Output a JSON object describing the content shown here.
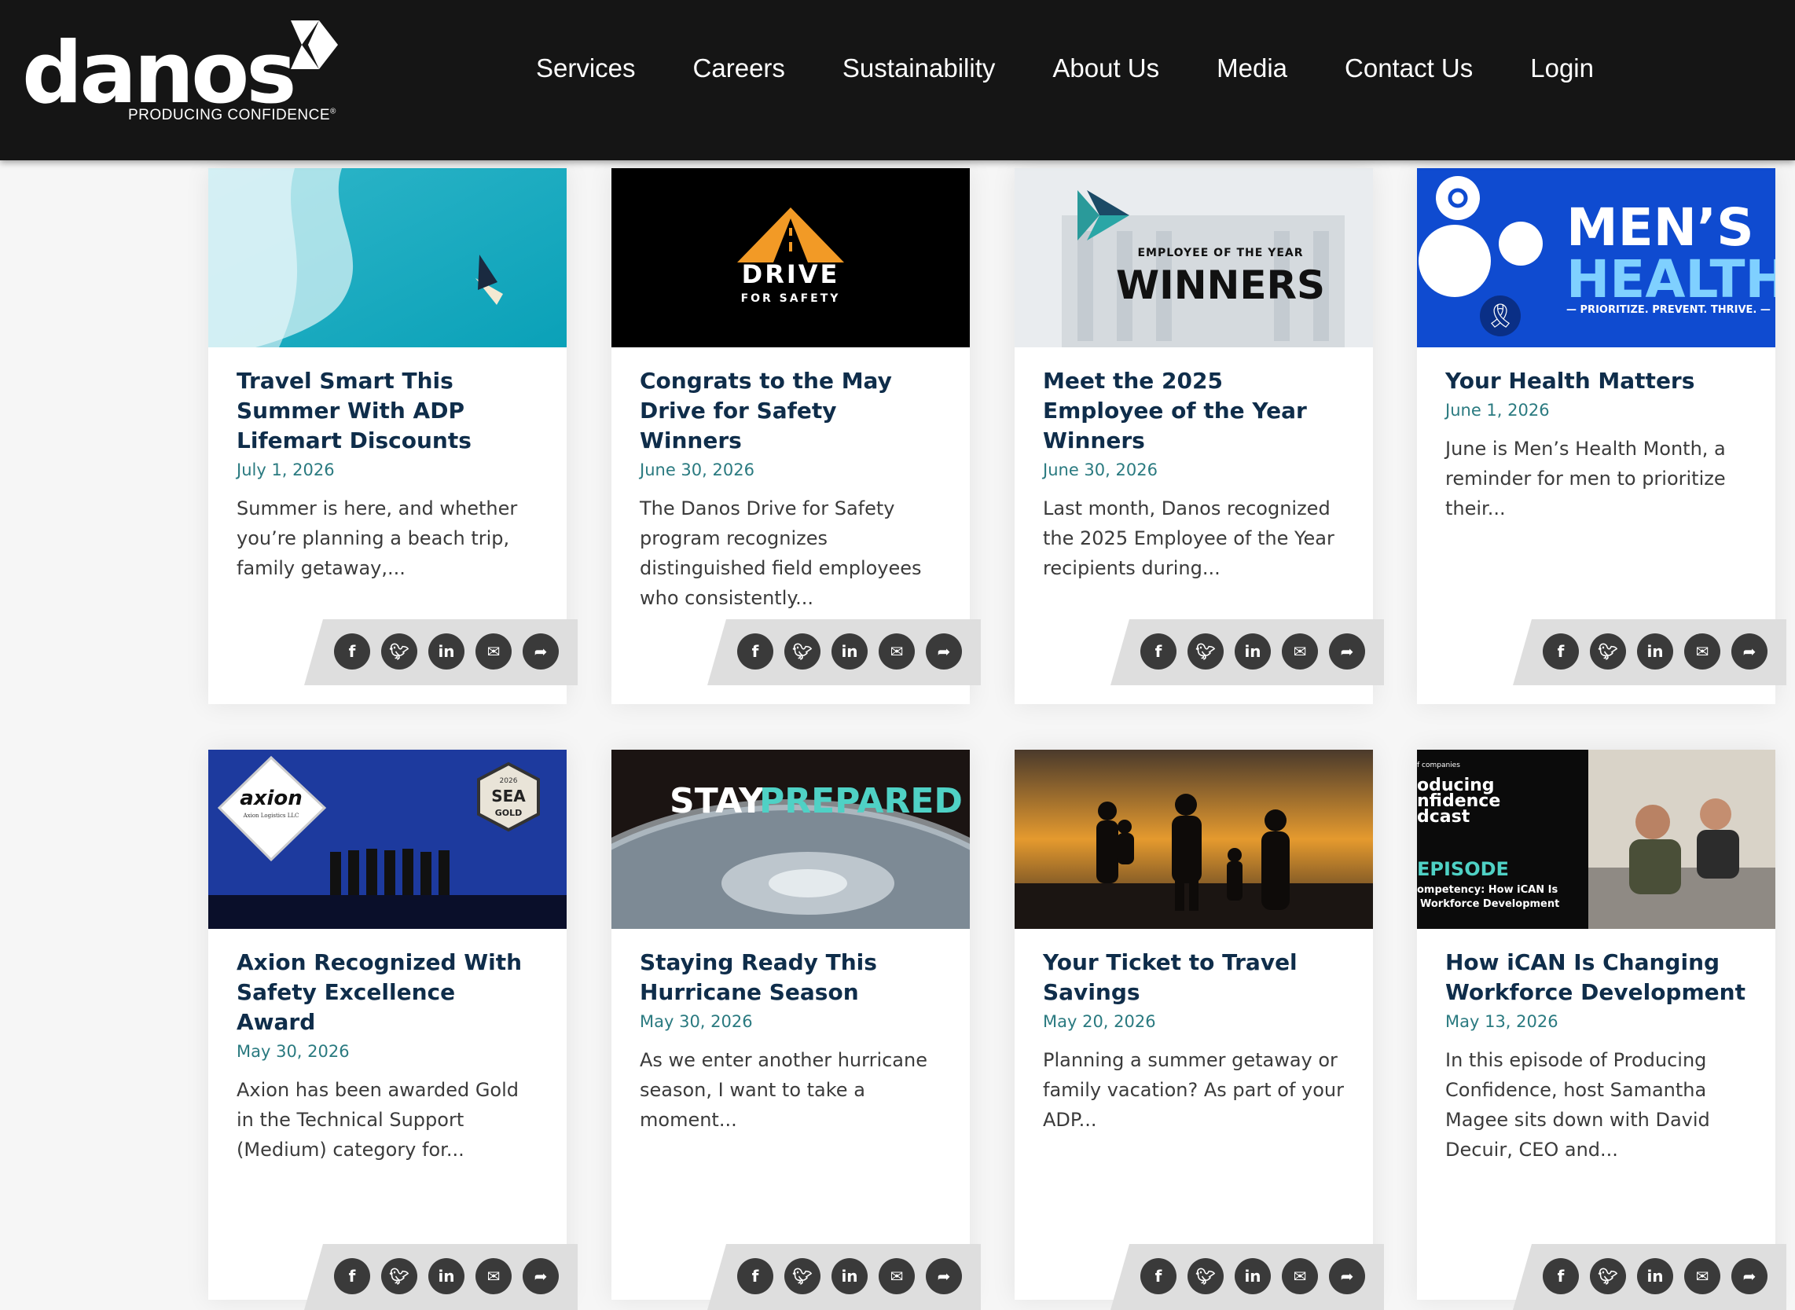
{
  "brand": {
    "logo_text": "danos",
    "tagline": "PRODUCING CONFIDENCE",
    "trademark": "®"
  },
  "nav": [
    {
      "label": "Services"
    },
    {
      "label": "Careers"
    },
    {
      "label": "Sustainability"
    },
    {
      "label": "About Us"
    },
    {
      "label": "Media"
    },
    {
      "label": "Contact Us"
    },
    {
      "label": "Login"
    }
  ],
  "share_icons": [
    "facebook-icon",
    "twitter-icon",
    "linkedin-icon",
    "email-icon",
    "share-icon"
  ],
  "colors": {
    "header": "#151515",
    "title": "#0f2d4a",
    "date": "#2a7a80",
    "text": "#3b3b3b",
    "icon_bg": "#3a3a3a"
  },
  "cards": [
    {
      "title": "Travel Smart This Summer With ADP Lifemart Discounts",
      "date": "July 1, 2026",
      "excerpt": "Summer is here, and whether you’re planning a beach trip, family getaway,...",
      "image": "aerial-ocean-sailboat"
    },
    {
      "title": "Congrats to the May Drive for Safety Winners",
      "date": "June 30, 2026",
      "excerpt": "The Danos Drive for Safety program recognizes distinguished field employees who consistently...",
      "image": "drive-for-safety-logo",
      "image_text": [
        "DRIVE",
        "FOR SAFETY"
      ]
    },
    {
      "title": "Meet the 2025 Employee of the Year Winners",
      "date": "June 30, 2026",
      "excerpt": "Last month, Danos recognized the 2025 Employee of the Year recipients during...",
      "image": "employee-of-year-banner",
      "image_text": [
        "EMPLOYEE OF THE YEAR",
        "WINNERS"
      ]
    },
    {
      "title": "Your Health Matters",
      "date": "June 1, 2026",
      "excerpt": "June is Men’s Health Month, a reminder for men to prioritize their...",
      "image": "mens-health-banner",
      "image_text": [
        "MEN’S",
        "HEALTH",
        "— PRIORITIZE. PREVENT. THRIVE. —"
      ]
    },
    {
      "title": "Axion Recognized With Safety Excellence Award",
      "date": "May 30, 2026",
      "excerpt": "Axion has been awarded Gold in the Technical Support (Medium) category for...",
      "image": "axion-award-stage",
      "image_text": [
        "axion",
        "Axion Logistics LLC",
        "2026",
        "SEA",
        "GOLD"
      ]
    },
    {
      "title": "Staying Ready This Hurricane Season",
      "date": "May 30, 2026",
      "excerpt": "As we enter another hurricane season, I want to take a moment...",
      "image": "hurricane-satellite",
      "image_text": [
        "STAY",
        "PREPARED"
      ]
    },
    {
      "title": "Your Ticket to Travel Savings",
      "date": "May 20, 2026",
      "excerpt": "Planning a summer getaway or family vacation? As part of your ADP...",
      "image": "family-sunset-silhouette"
    },
    {
      "title": "How iCAN Is Changing Workforce Development",
      "date": "May 13, 2026",
      "excerpt": "In this episode of Producing Confidence, host Samantha Magee sits down with David Decuir, CEO and...",
      "image": "podcast-episode-cover",
      "image_text": [
        "f companies",
        "oducing",
        "nfidence",
        "dcast",
        "EPISODE",
        "ompetency: How iCAN Is",
        "Workforce Development"
      ]
    }
  ]
}
